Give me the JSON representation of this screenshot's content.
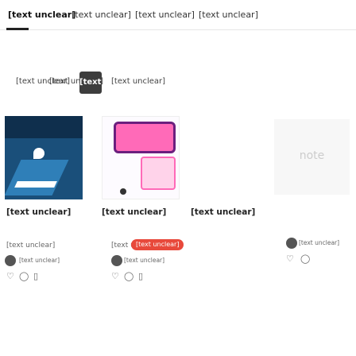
{
  "nav": {
    "tabs": [
      {
        "label": "[text unclear]"
      },
      {
        "label": "[text unclear]"
      },
      {
        "label": "[text unclear]"
      },
      {
        "label": "[text unclear]"
      }
    ]
  },
  "sort": {
    "options": [
      {
        "label": "[text unclear]"
      },
      {
        "label": "[text unclear]"
      },
      {
        "label": "[text unclear]"
      },
      {
        "label": "[text unclear]"
      }
    ]
  },
  "cards": [
    {
      "title": "[text unclear]",
      "price": "[text unclear]",
      "author": "[text unclear]"
    },
    {
      "title": "[text unclear]",
      "price": "[text unclear]",
      "pill": "[text unclear]",
      "author": "[text unclear]"
    },
    {
      "title": "[text unclear]",
      "thumb_text": "note",
      "author": "[text unclear]"
    }
  ],
  "colors": {
    "accent": "#e8493b",
    "selected_sort": "#3d3d3d"
  },
  "icons": [
    "heart-icon",
    "comment-icon",
    "bookmark-icon"
  ]
}
